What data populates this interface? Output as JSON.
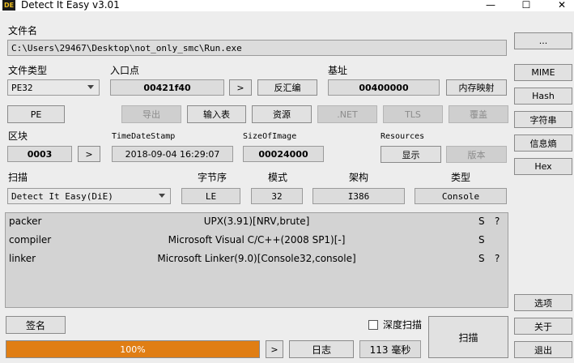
{
  "window": {
    "title": "Detect It Easy v3.01",
    "icon_text": "DE",
    "minimize": "—",
    "maximize": "☐",
    "close": "✕"
  },
  "file": {
    "label": "文件名",
    "path": "C:\\Users\\29467\\Desktop\\not_only_smc\\Run.exe",
    "browse_label": "..."
  },
  "filetype": {
    "label": "文件类型",
    "value": "PE32"
  },
  "entry": {
    "label": "入口点",
    "value": "00421f40",
    "go_label": ">",
    "disasm_label": "反汇编"
  },
  "base": {
    "label": "基址",
    "value": "00400000",
    "memmap_label": "内存映射"
  },
  "side": {
    "mime": "MIME",
    "hash": "Hash",
    "strings": "字符串",
    "entropy": "信息熵",
    "hex": "Hex",
    "options": "选项",
    "about": "关于",
    "exit": "退出"
  },
  "pe_button": "PE",
  "pe_tabs": {
    "export": "导出",
    "import": "输入表",
    "resources": "资源",
    "net": ".NET",
    "tls": "TLS",
    "overlay": "覆盖"
  },
  "sections": {
    "label": "区块",
    "value": "0003",
    "go_label": ">"
  },
  "timestamp": {
    "label": "TimeDateStamp",
    "value": "2018-09-04 16:29:07"
  },
  "size_of_image": {
    "label": "SizeOfImage",
    "value": "00024000"
  },
  "resources": {
    "label": "Resources",
    "show": "显示",
    "version": "版本"
  },
  "scan": {
    "label": "扫描",
    "engine": "Detect It Easy(DiE)"
  },
  "endian": {
    "label": "字节序",
    "value": "LE"
  },
  "mode": {
    "label": "模式",
    "value": "32"
  },
  "arch": {
    "label": "架构",
    "value": "I386"
  },
  "type": {
    "label": "类型",
    "value": "Console"
  },
  "results": [
    {
      "type": "packer",
      "value": "UPX(3.91)[NRV,brute]",
      "s": "S",
      "q": "?"
    },
    {
      "type": "compiler",
      "value": "Microsoft Visual C/C++(2008 SP1)[-]",
      "s": "S",
      "q": ""
    },
    {
      "type": "linker",
      "value": "Microsoft Linker(9.0)[Console32,console]",
      "s": "S",
      "q": "?"
    }
  ],
  "bottom": {
    "signatures": "签名",
    "deep_scan": "深度扫描",
    "scan": "扫描",
    "progress_text": "100%",
    "progress": 1.0,
    "next": ">",
    "log": "日志",
    "elapsed": "113 毫秒"
  },
  "colors": {
    "progress": "#e07e14",
    "results_bg": "#d3d3d3",
    "window_bg": "#ededed"
  }
}
